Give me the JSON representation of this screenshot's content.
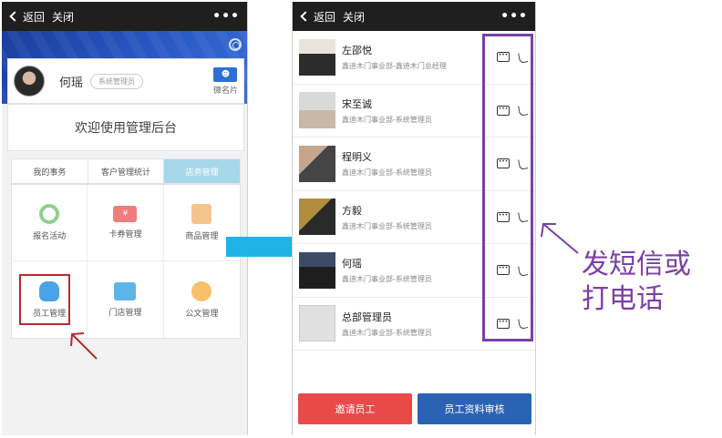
{
  "left": {
    "topbar": {
      "back_label": "返回",
      "close_label": "关闭",
      "more_label": "•••"
    },
    "profile": {
      "name": "何瑶",
      "role": "系统管理员",
      "vcard_label": "微名片"
    },
    "welcome": "欢迎使用管理后台",
    "tabs": [
      "我的事务",
      "客户管理统计",
      "店务管理"
    ],
    "grid": [
      "报名活动",
      "卡券管理",
      "商品管理",
      "员工管理",
      "门店管理",
      "公文管理"
    ]
  },
  "right": {
    "topbar": {
      "back_label": "返回",
      "close_label": "关闭",
      "more_label": "•••"
    },
    "contacts": [
      {
        "name": "左邵悦",
        "dept": "鑫迪木门事业部-鑫迪木门总经理"
      },
      {
        "name": "宋至诚",
        "dept": "鑫迪木门事业部-系统管理员"
      },
      {
        "name": "程明义",
        "dept": "鑫迪木门事业部-系统管理员"
      },
      {
        "name": "方毅",
        "dept": "鑫迪木门事业部-系统管理员"
      },
      {
        "name": "何瑶",
        "dept": "鑫迪木门事业部-系统管理员"
      },
      {
        "name": "总部管理员",
        "dept": "鑫迪木门事业部-系统管理员"
      }
    ],
    "buttons": {
      "invite": "邀请员工",
      "review": "员工资料审核"
    }
  },
  "annotation": {
    "line1": "发短信或",
    "line2": "打电话"
  },
  "colors": {
    "banner": "#2b5bc8",
    "active_tab": "#a7d8ea",
    "invite_button": "#e84a4a",
    "review_button": "#2a63b3",
    "highlight_red": "#b52b2b",
    "annotation_purple": "#7b3fa7",
    "arrow_blue": "#1fb3e8"
  }
}
